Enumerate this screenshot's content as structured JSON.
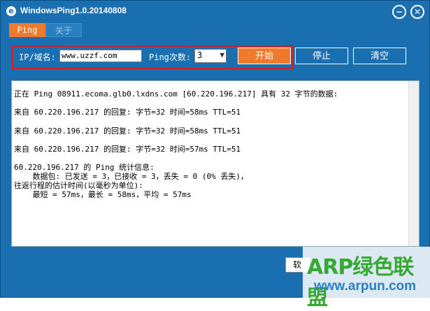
{
  "window": {
    "title": "WindowsPing1.0.20140808",
    "minimize_glyph": "−",
    "close_glyph": "✕",
    "app_icon_glyph": "e"
  },
  "tabs": [
    {
      "label": "Ping",
      "active": true
    },
    {
      "label": "关于",
      "active": false
    }
  ],
  "controls": {
    "host_label": "IP/域名:",
    "host_value": "www.uzzf.com",
    "count_label": "Ping次数:",
    "count_value": "3",
    "count_arrow": "▼",
    "start_label": "开始",
    "stop_label": "停止",
    "clear_label": "清空"
  },
  "output": {
    "lines": [
      "正在 Ping 08911.ecoma.glb0.lxdns.com [60.220.196.217] 具有 32 字节的数据:",
      "来自 60.220.196.217 的回复: 字节=32 时间=58ms TTL=51",
      "来自 60.220.196.217 的回复: 字节=32 时间=58ms TTL=51",
      "来自 60.220.196.217 的回复: 字节=32 时间=57ms TTL=51",
      "60.220.196.217 的 Ping 统计信息:",
      "    数据包: 已发送 = 3，已接收 = 3，丢失 = 0 (0% 丢失)，",
      "往返行程的估计时间(以毫秒为单位):",
      "    最短 = 57ms，最长 = 58ms，平均 = 57ms"
    ]
  },
  "footer": {
    "save_label": "软"
  },
  "watermark": {
    "brand": "ARP绿色联盟",
    "url": "www.arpun.com"
  },
  "colors": {
    "window_bg": "#1a6fb0",
    "accent_orange": "#f07a2c",
    "highlight_border": "#d0202a",
    "brand_green": "#37a833"
  }
}
